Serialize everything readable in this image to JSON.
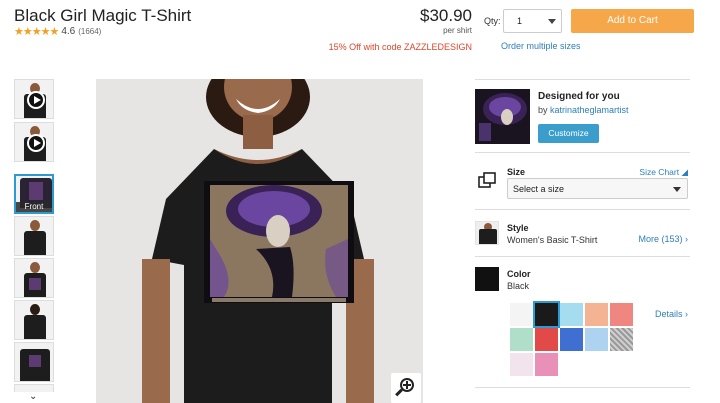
{
  "product": {
    "title": "Black Girl Magic T-Shirt",
    "stars": "★★★★★",
    "rating": "4.6",
    "review_count": "(1664)",
    "price": "$30.90",
    "price_unit": "per shirt",
    "promo": "15% Off with code ZAZZLEDESIGN"
  },
  "purchase": {
    "qty_label": "Qty:",
    "qty_value": "1",
    "add_to_cart": "Add to Cart",
    "order_multiple": "Order multiple sizes"
  },
  "thumbnails": {
    "front_label": "Front",
    "scroll_down": "⌄"
  },
  "designer": {
    "heading": "Designed for you",
    "by_prefix": "by ",
    "name": "katrinatheglamartist",
    "customize": "Customize"
  },
  "size": {
    "label": "Size",
    "chart_link": "Size Chart ◢",
    "placeholder": "Select a size"
  },
  "style": {
    "label": "Style",
    "value": "Women's Basic T-Shirt",
    "more": "More (153) ›"
  },
  "color": {
    "label": "Color",
    "value": "Black",
    "details": "Details ›",
    "swatches": [
      "#f4f4f4",
      "#1a1a1a",
      "#a6dcef",
      "#f4b393",
      "#ef8680",
      "#b0dfc9",
      "#e24a4a",
      "#3f6fd0",
      "#aed3f0",
      "heather",
      "#f2e4ec",
      "#e890b8"
    ],
    "selected_index": 1
  },
  "colors": {
    "accent_orange": "#f6a749",
    "link_blue": "#2d7fbc",
    "promo_red": "#e0452b",
    "star_gold": "#f3a01f"
  }
}
